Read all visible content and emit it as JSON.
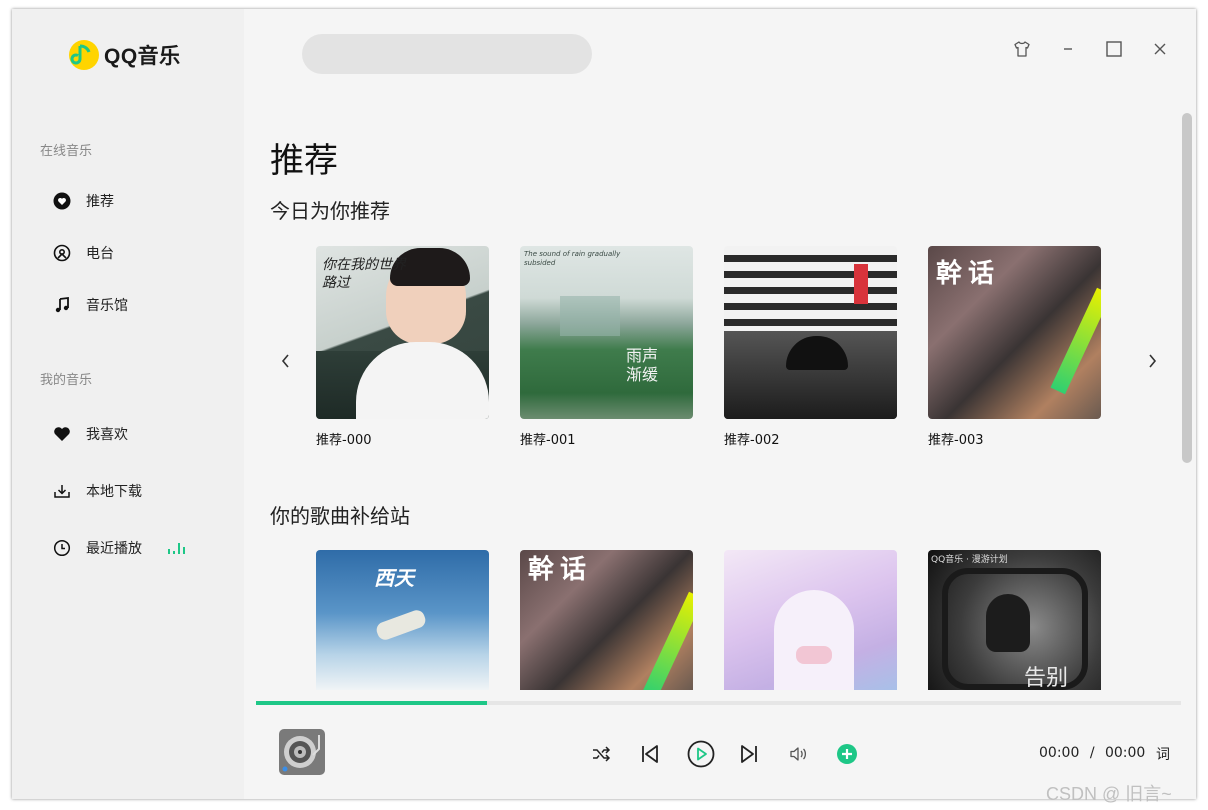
{
  "app": {
    "name": "QQ音乐"
  },
  "search": {
    "placeholder": "",
    "value": ""
  },
  "sidebar": {
    "online_title": "在线音乐",
    "online_items": [
      {
        "label": "推荐",
        "icon": "recommend-icon"
      },
      {
        "label": "电台",
        "icon": "radio-icon"
      },
      {
        "label": "音乐馆",
        "icon": "music-note-icon"
      }
    ],
    "mine_title": "我的音乐",
    "mine_items": [
      {
        "label": "我喜欢",
        "icon": "heart-icon"
      },
      {
        "label": "本地下载",
        "icon": "download-icon"
      },
      {
        "label": "最近播放",
        "icon": "clock-icon"
      }
    ]
  },
  "window_controls": [
    "skin-icon",
    "minimize-icon",
    "maximize-icon",
    "close-icon"
  ],
  "main": {
    "page_title": "推荐",
    "section1_title": "今日为你推荐",
    "section1_items": [
      {
        "label": "推荐-000",
        "cover_text": "你在我的世界路过"
      },
      {
        "label": "推荐-001",
        "cover_text": "雨声渐缓",
        "cover_text2": "The sound of rain gradually subsided"
      },
      {
        "label": "推荐-002",
        "cover_text": ""
      },
      {
        "label": "推荐-003",
        "cover_text": "幹话"
      }
    ],
    "section2_title": "你的歌曲补给站",
    "section2_items": [
      {
        "cover_text": "西天"
      },
      {
        "cover_text": "幹话"
      },
      {
        "cover_text": ""
      },
      {
        "cover_text": "告别",
        "cover_header": "QQ音乐 · 漫游计划"
      }
    ]
  },
  "player": {
    "progress": 0.25,
    "current_time": "00:00",
    "separator": "/",
    "total_time": "00:00",
    "lyric_label": "词",
    "accent_color": "#1ec787"
  },
  "watermark": "CSDN @ 旧言~"
}
